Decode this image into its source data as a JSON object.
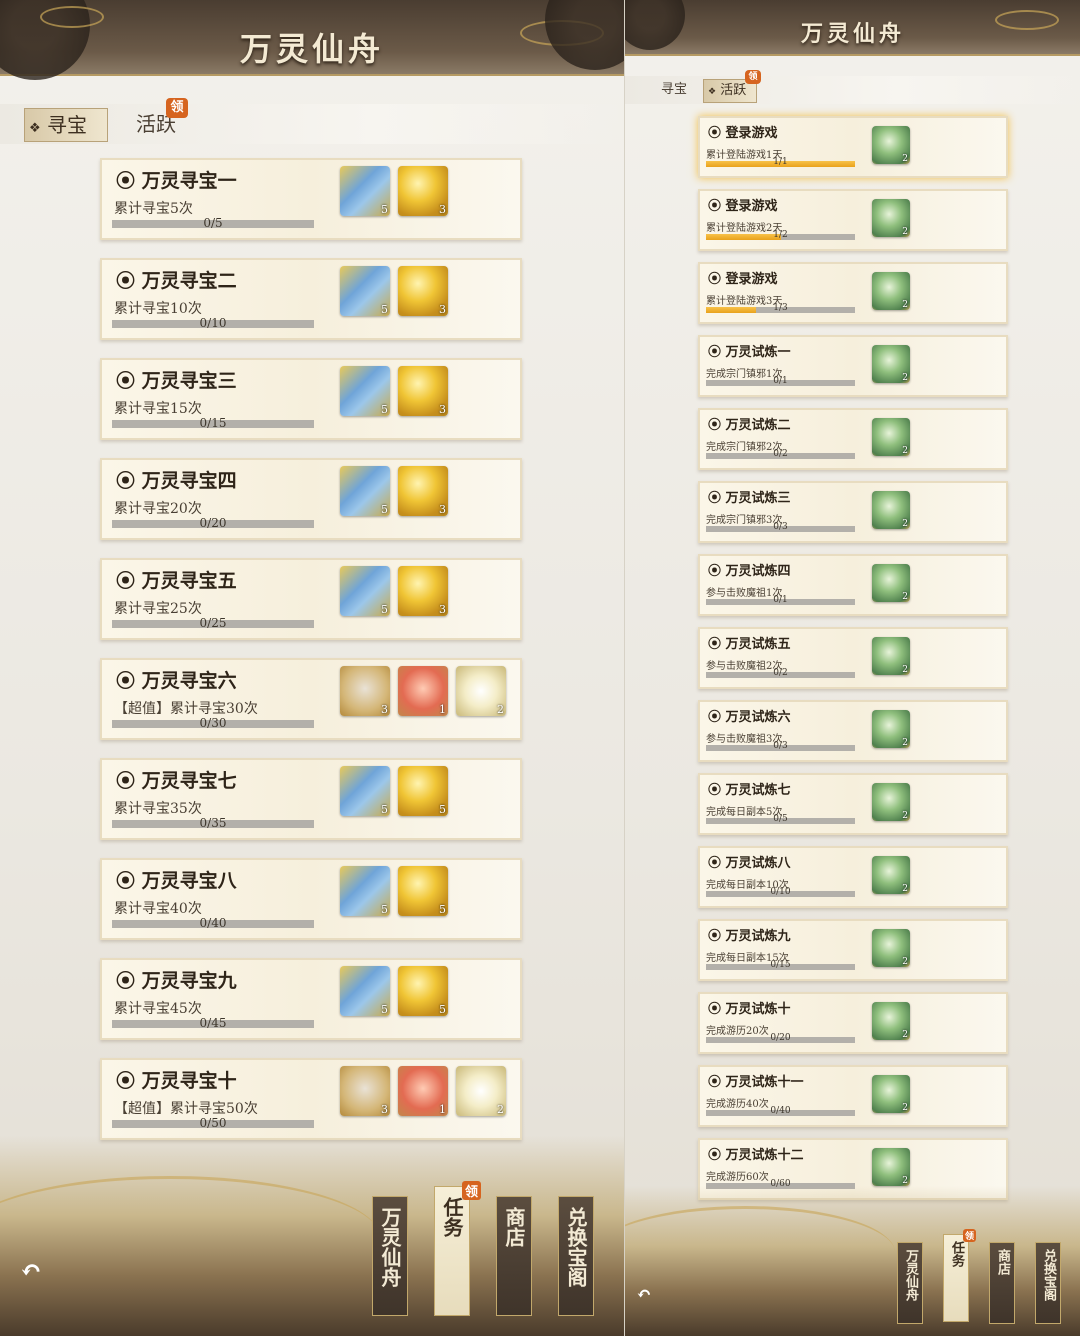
{
  "left": {
    "title": "万灵仙舟",
    "tabs": [
      {
        "label": "寻宝",
        "active": true
      },
      {
        "label": "活跃",
        "active": false,
        "badge": "领"
      }
    ],
    "quests": [
      {
        "name": "万灵寻宝一",
        "desc": "累计寻宝5次",
        "progress": "0/5",
        "items": [
          {
            "type": "scroll",
            "count": "5"
          },
          {
            "type": "gem",
            "count": "3"
          }
        ]
      },
      {
        "name": "万灵寻宝二",
        "desc": "累计寻宝10次",
        "progress": "0/10",
        "items": [
          {
            "type": "scroll",
            "count": "5"
          },
          {
            "type": "gem",
            "count": "3"
          }
        ]
      },
      {
        "name": "万灵寻宝三",
        "desc": "累计寻宝15次",
        "progress": "0/15",
        "items": [
          {
            "type": "scroll",
            "count": "5"
          },
          {
            "type": "gem",
            "count": "3"
          }
        ]
      },
      {
        "name": "万灵寻宝四",
        "desc": "累计寻宝20次",
        "progress": "0/20",
        "items": [
          {
            "type": "scroll",
            "count": "5"
          },
          {
            "type": "gem",
            "count": "3"
          }
        ]
      },
      {
        "name": "万灵寻宝五",
        "desc": "累计寻宝25次",
        "progress": "0/25",
        "items": [
          {
            "type": "scroll",
            "count": "5"
          },
          {
            "type": "gem",
            "count": "3"
          }
        ]
      },
      {
        "name": "万灵寻宝六",
        "desc": "【超值】累计寻宝30次",
        "progress": "0/30",
        "items": [
          {
            "type": "hero",
            "count": "3"
          },
          {
            "type": "peach",
            "count": "1"
          },
          {
            "type": "lotus",
            "count": "2"
          }
        ]
      },
      {
        "name": "万灵寻宝七",
        "desc": "累计寻宝35次",
        "progress": "0/35",
        "items": [
          {
            "type": "scroll",
            "count": "5"
          },
          {
            "type": "gem",
            "count": "5"
          }
        ]
      },
      {
        "name": "万灵寻宝八",
        "desc": "累计寻宝40次",
        "progress": "0/40",
        "items": [
          {
            "type": "scroll",
            "count": "5"
          },
          {
            "type": "gem",
            "count": "5"
          }
        ]
      },
      {
        "name": "万灵寻宝九",
        "desc": "累计寻宝45次",
        "progress": "0/45",
        "items": [
          {
            "type": "scroll",
            "count": "5"
          },
          {
            "type": "gem",
            "count": "5"
          }
        ]
      },
      {
        "name": "万灵寻宝十",
        "desc": "【超值】累计寻宝50次",
        "progress": "0/50",
        "items": [
          {
            "type": "hero",
            "count": "3"
          },
          {
            "type": "peach",
            "count": "1"
          },
          {
            "type": "lotus",
            "count": "2"
          }
        ]
      }
    ],
    "nav": [
      {
        "label": "万灵仙舟",
        "active": false
      },
      {
        "label": "任务",
        "active": true,
        "badge": "领"
      },
      {
        "label": "商店",
        "active": false
      },
      {
        "label": "兑换宝阁",
        "active": false
      }
    ],
    "back_icon": "back-arrow-icon"
  },
  "right": {
    "title": "万灵仙舟",
    "tabs": [
      {
        "label": "寻宝",
        "active": false
      },
      {
        "label": "活跃",
        "active": true,
        "badge": "领"
      }
    ],
    "quests": [
      {
        "name": "登录游戏",
        "desc": "累计登陆游戏1天",
        "progress": "1/1",
        "fill": 1.0,
        "highlight": true,
        "items": [
          {
            "type": "jade",
            "count": "2"
          }
        ]
      },
      {
        "name": "登录游戏",
        "desc": "累计登陆游戏2天",
        "progress": "1/2",
        "fill": 0.5,
        "items": [
          {
            "type": "jade",
            "count": "2"
          }
        ]
      },
      {
        "name": "登录游戏",
        "desc": "累计登陆游戏3天",
        "progress": "1/3",
        "fill": 0.333,
        "items": [
          {
            "type": "jade",
            "count": "2"
          }
        ]
      },
      {
        "name": "万灵试炼一",
        "desc": "完成宗门镇邪1次",
        "progress": "0/1",
        "fill": 0,
        "items": [
          {
            "type": "jade",
            "count": "2"
          }
        ]
      },
      {
        "name": "万灵试炼二",
        "desc": "完成宗门镇邪2次",
        "progress": "0/2",
        "fill": 0,
        "items": [
          {
            "type": "jade",
            "count": "2"
          }
        ]
      },
      {
        "name": "万灵试炼三",
        "desc": "完成宗门镇邪3次",
        "progress": "0/3",
        "fill": 0,
        "items": [
          {
            "type": "jade",
            "count": "2"
          }
        ]
      },
      {
        "name": "万灵试炼四",
        "desc": "参与击败魔祖1次",
        "progress": "0/1",
        "fill": 0,
        "items": [
          {
            "type": "jade",
            "count": "2"
          }
        ]
      },
      {
        "name": "万灵试炼五",
        "desc": "参与击败魔祖2次",
        "progress": "0/2",
        "fill": 0,
        "items": [
          {
            "type": "jade",
            "count": "2"
          }
        ]
      },
      {
        "name": "万灵试炼六",
        "desc": "参与击败魔祖3次",
        "progress": "0/3",
        "fill": 0,
        "items": [
          {
            "type": "jade",
            "count": "2"
          }
        ]
      },
      {
        "name": "万灵试炼七",
        "desc": "完成每日副本5次",
        "progress": "0/5",
        "fill": 0,
        "items": [
          {
            "type": "jade",
            "count": "2"
          }
        ]
      },
      {
        "name": "万灵试炼八",
        "desc": "完成每日副本10次",
        "progress": "0/10",
        "fill": 0,
        "items": [
          {
            "type": "jade",
            "count": "2"
          }
        ]
      },
      {
        "name": "万灵试炼九",
        "desc": "完成每日副本15次",
        "progress": "0/15",
        "fill": 0,
        "items": [
          {
            "type": "jade",
            "count": "2"
          }
        ]
      },
      {
        "name": "万灵试炼十",
        "desc": "完成游历20次",
        "progress": "0/20",
        "fill": 0,
        "items": [
          {
            "type": "jade",
            "count": "2"
          }
        ]
      },
      {
        "name": "万灵试炼十一",
        "desc": "完成游历40次",
        "progress": "0/40",
        "fill": 0,
        "items": [
          {
            "type": "jade",
            "count": "2"
          }
        ]
      },
      {
        "name": "万灵试炼十二",
        "desc": "完成游历60次",
        "progress": "0/60",
        "fill": 0,
        "items": [
          {
            "type": "jade",
            "count": "2"
          }
        ]
      }
    ],
    "nav": [
      {
        "label": "万灵仙舟",
        "active": false
      },
      {
        "label": "任务",
        "active": true,
        "badge": "领"
      },
      {
        "label": "商店",
        "active": false
      },
      {
        "label": "兑换宝阁",
        "active": false
      }
    ],
    "back_icon": "back-arrow-icon"
  },
  "colors": {
    "accent": "#d6641f",
    "progress_fill": "#e9a21b",
    "header": "#4a3d31",
    "gold": "#c9a658"
  }
}
